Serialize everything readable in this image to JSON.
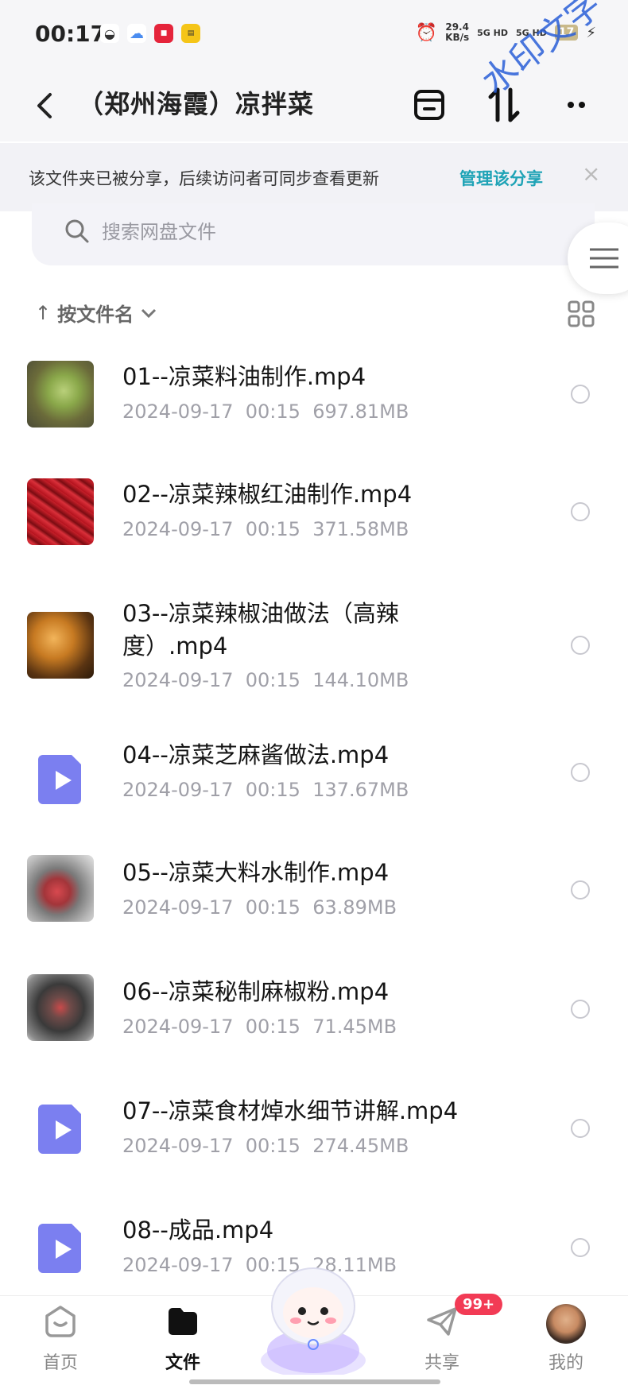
{
  "status_bar": {
    "time": "00:17",
    "speed_value": "29.4",
    "speed_unit": "KB/s",
    "signal_1": "5G HD",
    "signal_2": "5G HD",
    "battery": "17"
  },
  "header": {
    "title": "（郑州海霞）凉拌菜",
    "watermark": "水印文字"
  },
  "share_banner": {
    "text": "该文件夹已被分享，后续访问者可同步查看更新",
    "link": "管理该分享",
    "close": "×"
  },
  "search": {
    "placeholder": "搜索网盘文件"
  },
  "sort": {
    "arrow": "↑",
    "label": "按文件名"
  },
  "files": [
    {
      "name": "01--凉菜料油制作.mp4",
      "date": "2024-09-17",
      "time": "00:15",
      "size": "697.81MB"
    },
    {
      "name": "02--凉菜辣椒红油制作.mp4",
      "date": "2024-09-17",
      "time": "00:15",
      "size": "371.58MB"
    },
    {
      "name": "03--凉菜辣椒油做法（高辣度）.mp4",
      "date": "2024-09-17",
      "time": "00:15",
      "size": "144.10MB"
    },
    {
      "name": "04--凉菜芝麻酱做法.mp4",
      "date": "2024-09-17",
      "time": "00:15",
      "size": "137.67MB"
    },
    {
      "name": "05--凉菜大料水制作.mp4",
      "date": "2024-09-17",
      "time": "00:15",
      "size": "63.89MB"
    },
    {
      "name": "06--凉菜秘制麻椒粉.mp4",
      "date": "2024-09-17",
      "time": "00:15",
      "size": "71.45MB"
    },
    {
      "name": "07--凉菜食材焯水细节讲解.mp4",
      "date": "2024-09-17",
      "time": "00:15",
      "size": "274.45MB"
    },
    {
      "name": "08--成品.mp4",
      "date": "2024-09-17",
      "time": "00:15",
      "size": "28.11MB"
    }
  ],
  "nav": {
    "home": "首页",
    "files": "文件",
    "share": "共享",
    "mine": "我的",
    "share_badge": "99+"
  },
  "colors": {
    "accent": "#1fa3b6",
    "video_icon": "#7b7ff0",
    "badge": "#f23b55"
  }
}
